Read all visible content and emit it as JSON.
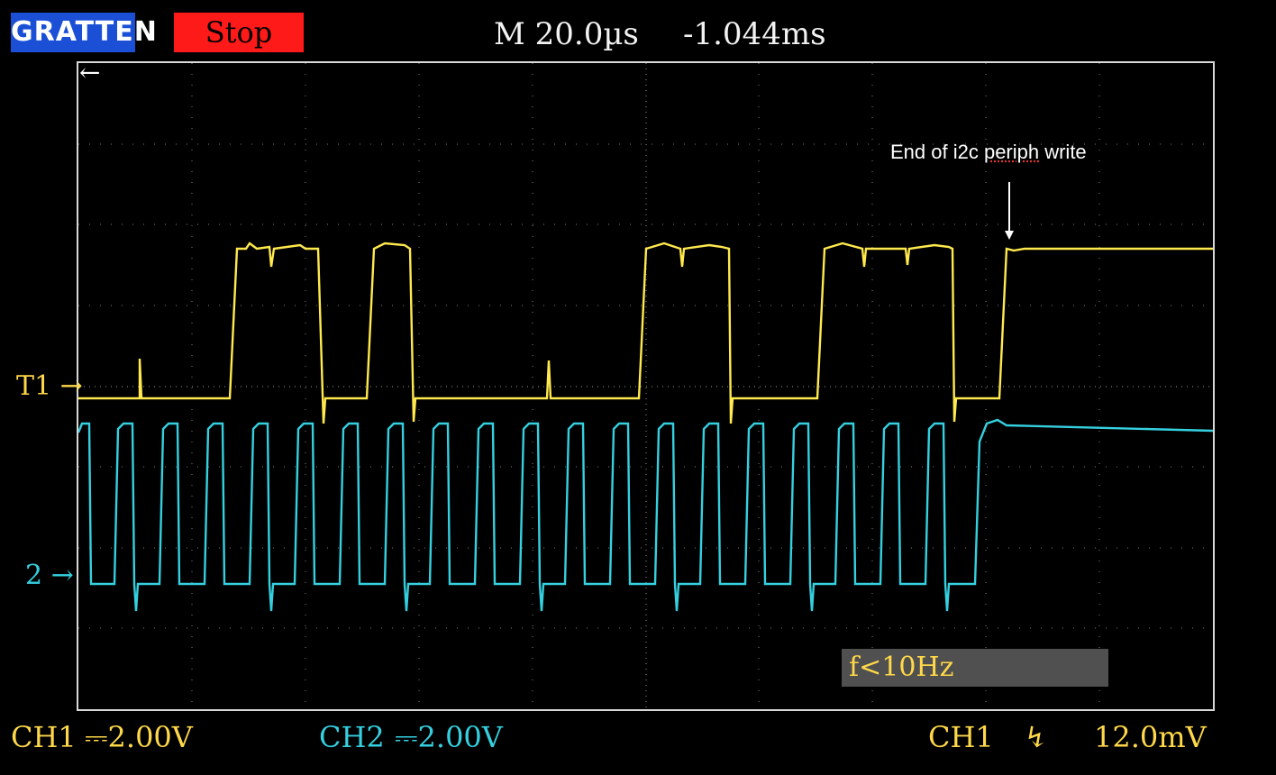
{
  "header": {
    "brand": "GRATTEN",
    "run_state": "Stop",
    "timebase": "M 20.0µs",
    "position": "-1.044ms"
  },
  "markers": {
    "ch1": "T1 →",
    "ch2": "2 →",
    "top_arrow": "←"
  },
  "annotation": {
    "text_prefix": "End of i2c ",
    "text_underlined": "periph",
    "text_suffix": " write"
  },
  "frequency_readout": "f<10Hz",
  "footer": {
    "ch1_label": "CH1",
    "ch1_scale": "⎓2.00V",
    "ch2_label": "CH2",
    "ch2_scale": "⎓2.00V",
    "trigger_source": "CH1",
    "trigger_slope_icon": "falling-edge",
    "trigger_slope_glyph": "↯",
    "trigger_level": "12.0mV"
  },
  "colors": {
    "ch1": "#ffe94d",
    "ch2": "#35d0e0",
    "stop": "#ff1a1a",
    "brand": "#1a4fd6"
  }
}
